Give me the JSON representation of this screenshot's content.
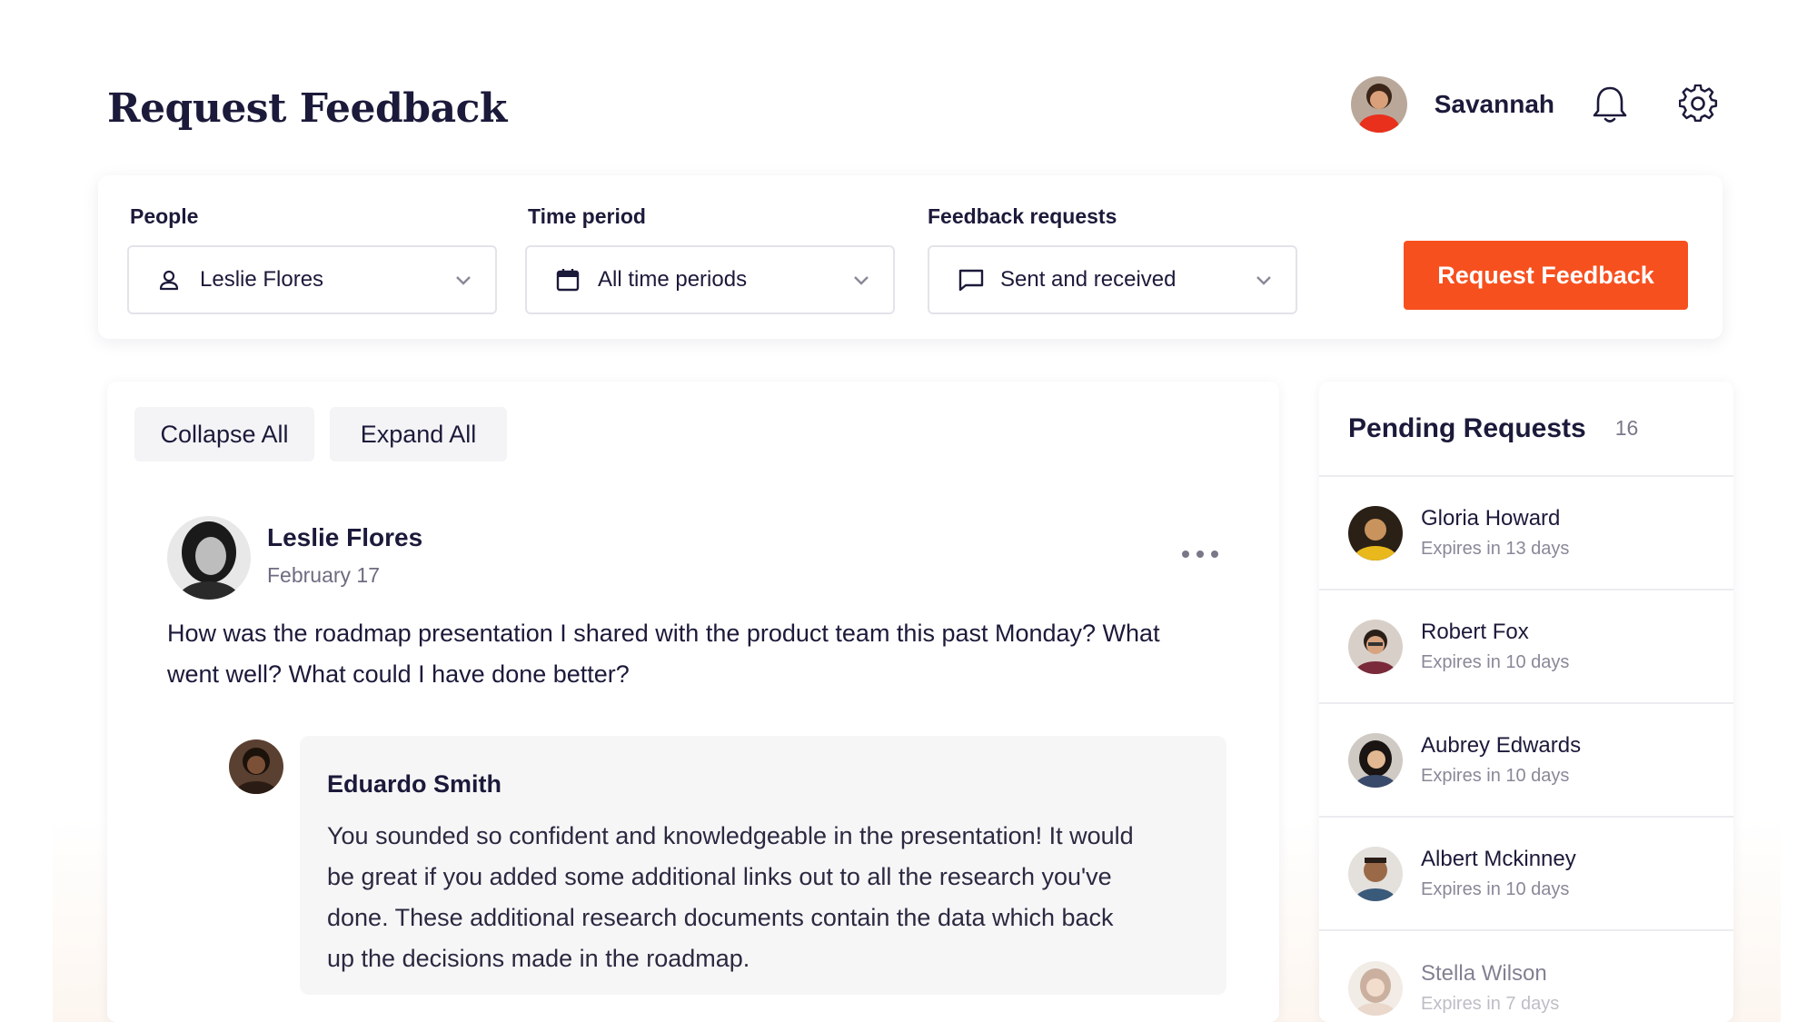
{
  "header": {
    "title": "Request Feedback",
    "user_name": "Savannah"
  },
  "filters": {
    "people": {
      "label": "People",
      "value": "Leslie Flores"
    },
    "time_period": {
      "label": "Time period",
      "value": "All time periods"
    },
    "feedback_requests": {
      "label": "Feedback requests",
      "value": "Sent and received"
    },
    "request_button": "Request Feedback"
  },
  "feed": {
    "collapse_all": "Collapse All",
    "expand_all": "Expand All",
    "post": {
      "author": "Leslie Flores",
      "date": "February 17",
      "body": "How was the roadmap presentation I shared with the product team this past Monday? What went well? What could I have done better?"
    },
    "reply": {
      "author": "Eduardo Smith",
      "body": "You sounded so confident and knowledgeable in the presentation! It would be great if you added some additional links out to all the research you've done. These additional research documents contain the data which back up the decisions made in the roadmap."
    }
  },
  "pending": {
    "title": "Pending Requests",
    "count": "16",
    "items": [
      {
        "name": "Gloria Howard",
        "expires": "Expires in 13 days"
      },
      {
        "name": "Robert Fox",
        "expires": "Expires in 10 days"
      },
      {
        "name": "Aubrey Edwards",
        "expires": "Expires in 10 days"
      },
      {
        "name": "Albert Mckinney",
        "expires": "Expires in 10 days"
      },
      {
        "name": "Stella Wilson",
        "expires": "Expires in 7 days"
      }
    ]
  },
  "colors": {
    "accent": "#f7501f",
    "text_primary": "#1c1a3a",
    "text_muted": "#7a7888"
  },
  "icons": [
    "bell-icon",
    "gear-icon",
    "person-icon",
    "calendar-icon",
    "chat-bubble-icon",
    "chevron-down-icon",
    "more-dots-icon"
  ]
}
